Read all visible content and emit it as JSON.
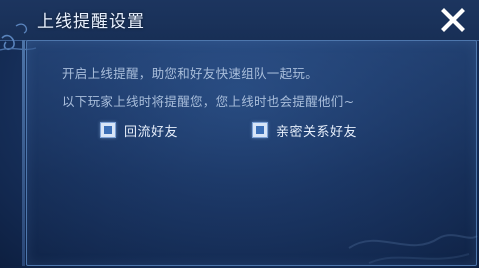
{
  "dialog": {
    "title": "上线提醒设置",
    "close_icon": "close-icon"
  },
  "content": {
    "line1": "开启上线提醒，助您和好友快速组队一起玩。",
    "line2": "以下玩家上线时将提醒您，您上线时也会提醒他们~"
  },
  "options": [
    {
      "label": "回流好友",
      "checked": true
    },
    {
      "label": "亲密关系好友",
      "checked": true
    }
  ],
  "colors": {
    "accent": "#3c6fb6",
    "panel_bg": "#1b3766",
    "title_text": "#eaf2ff",
    "body_text": "#a9bedb"
  }
}
